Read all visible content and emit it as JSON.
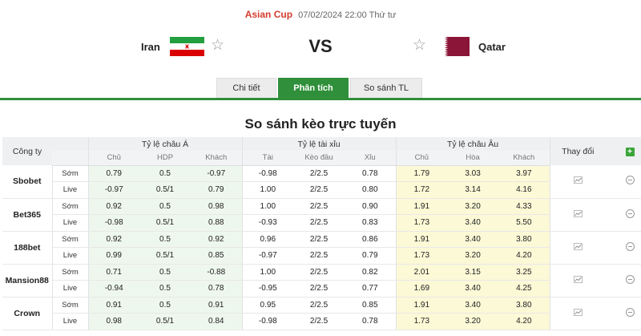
{
  "match": {
    "league": "Asian Cup",
    "datetime": "07/02/2024 22:00 Thứ tư",
    "home_team": "Iran",
    "away_team": "Qatar",
    "vs_label": "VS",
    "home_flag_icon": "iran-flag-icon",
    "away_flag_icon": "qatar-flag-icon",
    "star_icon": "star-outline-icon"
  },
  "tabs": [
    {
      "label": "Chi tiết",
      "active": false
    },
    {
      "label": "Phân tích",
      "active": true
    },
    {
      "label": "So sánh TL",
      "active": false
    }
  ],
  "section_title": "So sánh kèo trực tuyến",
  "table": {
    "headers": {
      "company": "Công ty",
      "asian": "Tỷ lệ châu Á",
      "overunder": "Tỷ lệ tài xỉu",
      "european": "Tỷ lệ châu Âu",
      "change": "Thay đổi",
      "add_label": "+"
    },
    "subheaders": {
      "asian": [
        "Chủ",
        "HDP",
        "Khách"
      ],
      "overunder": [
        "Tài",
        "Kèo đầu",
        "Xỉu"
      ],
      "european": [
        "Chủ",
        "Hòa",
        "Khách"
      ]
    },
    "companies": [
      {
        "name": "Sbobet",
        "rows": [
          {
            "kind": "Sớm",
            "asian": [
              "0.79",
              "0.5",
              "-0.97"
            ],
            "ou": [
              "-0.98",
              "2/2.5",
              "0.78"
            ],
            "eu": [
              "1.79",
              "3.03",
              "3.97"
            ]
          },
          {
            "kind": "Live",
            "asian": [
              "-0.97",
              "0.5/1",
              "0.79"
            ],
            "ou": [
              "1.00",
              "2/2.5",
              "0.80"
            ],
            "eu": [
              "1.72",
              "3.14",
              "4.16"
            ]
          }
        ]
      },
      {
        "name": "Bet365",
        "rows": [
          {
            "kind": "Sớm",
            "asian": [
              "0.92",
              "0.5",
              "0.98"
            ],
            "ou": [
              "1.00",
              "2/2.5",
              "0.90"
            ],
            "eu": [
              "1.91",
              "3.20",
              "4.33"
            ]
          },
          {
            "kind": "Live",
            "asian": [
              "-0.98",
              "0.5/1",
              "0.88"
            ],
            "ou": [
              "-0.93",
              "2/2.5",
              "0.83"
            ],
            "eu": [
              "1.73",
              "3.40",
              "5.50"
            ]
          }
        ]
      },
      {
        "name": "188bet",
        "rows": [
          {
            "kind": "Sớm",
            "asian": [
              "0.92",
              "0.5",
              "0.92"
            ],
            "ou": [
              "0.96",
              "2/2.5",
              "0.86"
            ],
            "eu": [
              "1.91",
              "3.40",
              "3.80"
            ]
          },
          {
            "kind": "Live",
            "asian": [
              "0.99",
              "0.5/1",
              "0.85"
            ],
            "ou": [
              "-0.97",
              "2/2.5",
              "0.79"
            ],
            "eu": [
              "1.73",
              "3.20",
              "4.20"
            ]
          }
        ]
      },
      {
        "name": "Mansion88",
        "rows": [
          {
            "kind": "Sớm",
            "asian": [
              "0.71",
              "0.5",
              "-0.88"
            ],
            "ou": [
              "1.00",
              "2/2.5",
              "0.82"
            ],
            "eu": [
              "2.01",
              "3.15",
              "3.25"
            ]
          },
          {
            "kind": "Live",
            "asian": [
              "-0.94",
              "0.5",
              "0.78"
            ],
            "ou": [
              "-0.95",
              "2/2.5",
              "0.77"
            ],
            "eu": [
              "1.69",
              "3.40",
              "4.25"
            ]
          }
        ]
      },
      {
        "name": "Crown",
        "rows": [
          {
            "kind": "Sớm",
            "asian": [
              "0.91",
              "0.5",
              "0.91"
            ],
            "ou": [
              "0.95",
              "2/2.5",
              "0.85"
            ],
            "eu": [
              "1.91",
              "3.40",
              "3.80"
            ]
          },
          {
            "kind": "Live",
            "asian": [
              "0.98",
              "0.5/1",
              "0.84"
            ],
            "ou": [
              "-0.98",
              "2/2.5",
              "0.78"
            ],
            "eu": [
              "1.73",
              "3.20",
              "4.20"
            ]
          }
        ]
      }
    ],
    "chart_icon": "line-chart-icon",
    "remove_icon": "circle-minus-icon"
  },
  "colors": {
    "accent_green": "#2f8f3a",
    "league_red": "#d33c2e",
    "asian_bg": "#eef7ee",
    "euro_bg": "#fbf9d6"
  }
}
